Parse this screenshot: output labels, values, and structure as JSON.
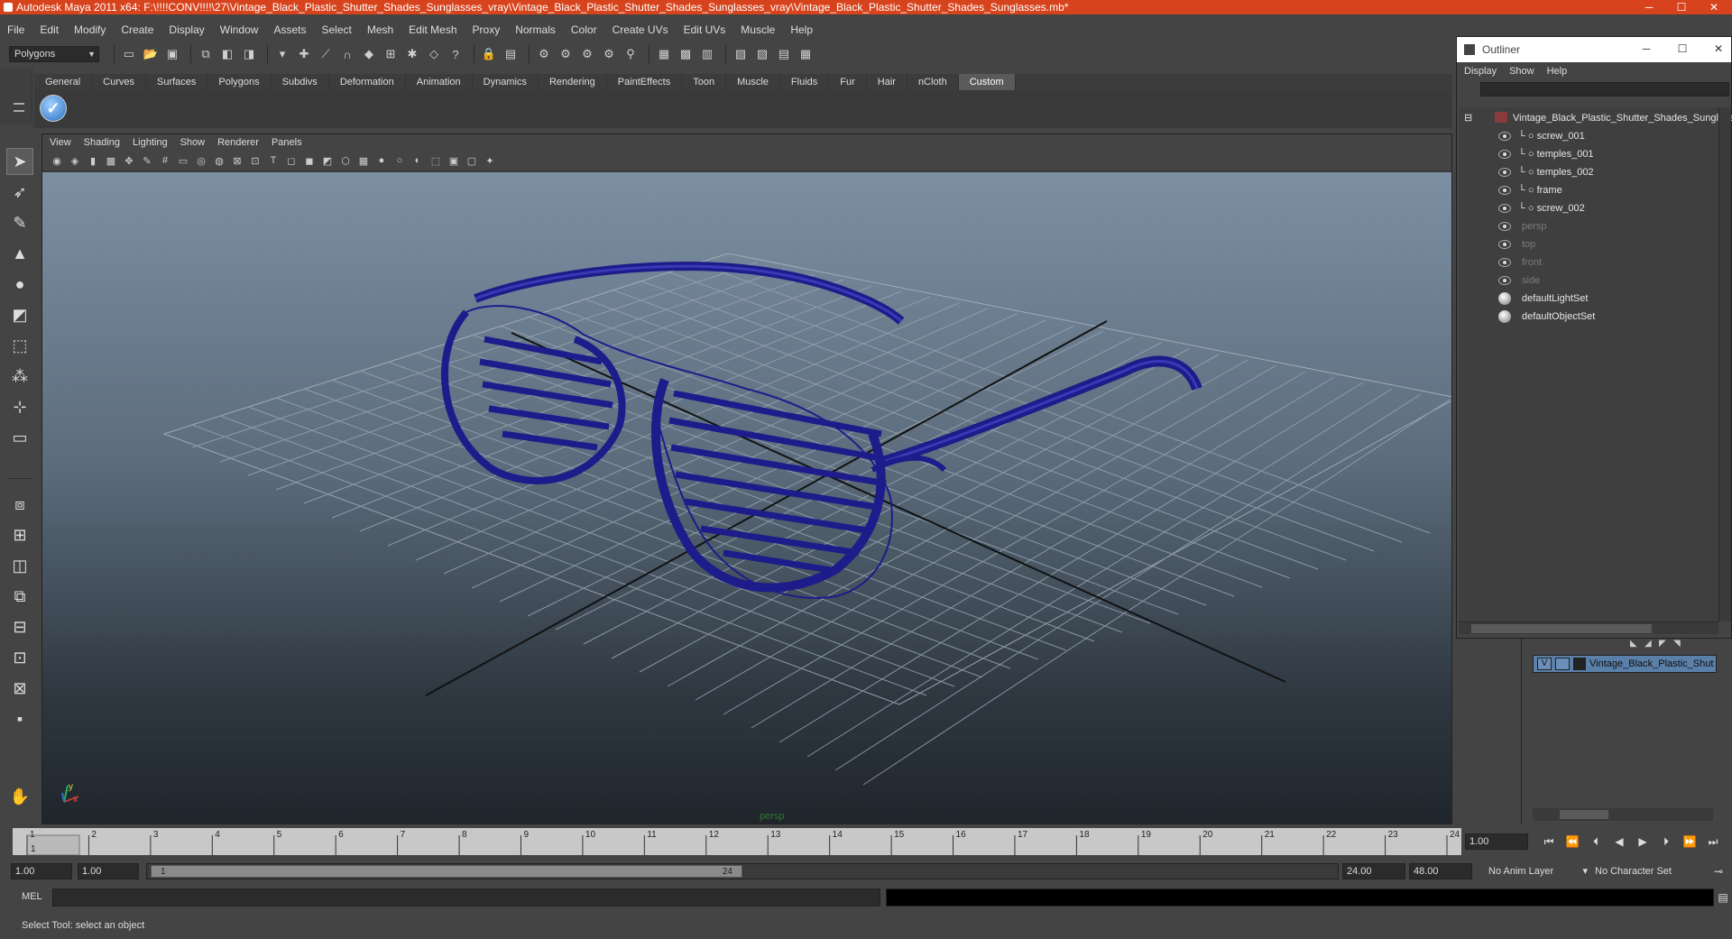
{
  "window": {
    "title": "Autodesk Maya 2011 x64: F:\\!!!!CONV!!!!\\27\\Vintage_Black_Plastic_Shutter_Shades_Sunglasses_vray\\Vintage_Black_Plastic_Shutter_Shades_Sunglasses_vray\\Vintage_Black_Plastic_Shutter_Shades_Sunglasses.mb*",
    "controls": {
      "minimize": "─",
      "maximize": "☐",
      "close": "✕"
    }
  },
  "menubar": [
    "File",
    "Edit",
    "Modify",
    "Create",
    "Display",
    "Window",
    "Assets",
    "Select",
    "Mesh",
    "Edit Mesh",
    "Proxy",
    "Normals",
    "Color",
    "Create UVs",
    "Edit UVs",
    "Muscle",
    "Help"
  ],
  "statusline": {
    "mode": "Polygons",
    "icons": [
      "new-scene-icon",
      "open-scene-icon",
      "save-scene-icon",
      "select-hierarchy-icon",
      "select-object-icon",
      "select-component-icon",
      "filter-icon",
      "snap-grid-icon",
      "snap-curve-icon",
      "snap-point-icon",
      "snap-plane-icon",
      "make-live-icon",
      "history-icon",
      "render-icon",
      "ipr-render-icon",
      "render-settings-icon",
      "hypershade-icon",
      "channel-box-icon"
    ]
  },
  "shelf": {
    "tabs": [
      "General",
      "Curves",
      "Surfaces",
      "Polygons",
      "Subdivs",
      "Deformation",
      "Animation",
      "Dynamics",
      "Rendering",
      "PaintEffects",
      "Toon",
      "Muscle",
      "Fluids",
      "Fur",
      "Hair",
      "nCloth",
      "Custom"
    ],
    "active_tab": "Custom",
    "shelf_icon": "checkmark-icon"
  },
  "toolbox": [
    "select-tool-icon",
    "lasso-tool-icon",
    "paint-select-icon",
    "move-tool-icon",
    "rotate-tool-icon",
    "scale-tool-icon",
    "universal-manip-icon",
    "soft-mod-icon",
    "show-manip-icon"
  ],
  "viewport": {
    "menu": [
      "View",
      "Shading",
      "Lighting",
      "Show",
      "Renderer",
      "Panels"
    ],
    "camera_label": "persp",
    "axis": {
      "x": "x",
      "y": "y"
    }
  },
  "outliner": {
    "title": "Outliner",
    "menu": [
      "Display",
      "Show",
      "Help"
    ],
    "root": "Vintage_Black_Plastic_Shutter_Shades_Sunglasses",
    "children": [
      "screw_001",
      "temples_001",
      "temples_002",
      "frame",
      "screw_002"
    ],
    "cameras": [
      "persp",
      "top",
      "front",
      "side"
    ],
    "sets": [
      "defaultLightSet",
      "defaultObjectSet"
    ]
  },
  "layers": {
    "visibility": "V",
    "name": "Vintage_Black_Plastic_Shutter_Shades_Sunglasses"
  },
  "timeline": {
    "ticks": [
      "1",
      "2",
      "3",
      "4",
      "5",
      "6",
      "7",
      "8",
      "9",
      "10",
      "11",
      "12",
      "13",
      "14",
      "15",
      "16",
      "17",
      "18",
      "19",
      "20",
      "21",
      "22",
      "23",
      "24"
    ],
    "current_frame": "1.00"
  },
  "range": {
    "start": "1.00",
    "playback_start": "1.00",
    "thumb_start": "1",
    "thumb_end": "24",
    "playback_end": "24.00",
    "end": "48.00",
    "anim_layer": "No Anim Layer",
    "char_set": "No Character Set"
  },
  "cmdline": {
    "label": "MEL"
  },
  "helpline": {
    "text": "Select Tool: select an object"
  }
}
